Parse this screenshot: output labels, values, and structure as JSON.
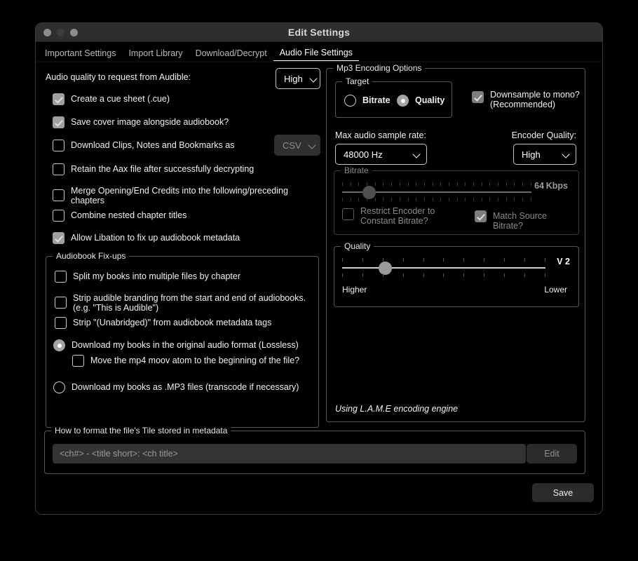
{
  "window": {
    "title": "Edit Settings",
    "traffic_lights": [
      "close-light",
      "minimize-light",
      "zoom-light"
    ]
  },
  "tabs": [
    {
      "label": "Important Settings",
      "active": false
    },
    {
      "label": "Import Library",
      "active": false
    },
    {
      "label": "Download/Decrypt",
      "active": false
    },
    {
      "label": "Audio File Settings",
      "active": true
    }
  ],
  "left": {
    "audio_quality_label": "Audio quality to request from Audible:",
    "audio_quality_value": "High",
    "checks": [
      {
        "label": "Create a cue sheet (.cue)",
        "checked": true
      },
      {
        "label": "Save cover image alongside audiobook?",
        "checked": true
      },
      {
        "label": "Download Clips, Notes and Bookmarks as",
        "checked": false
      },
      {
        "label": "Retain the Aax file after successfully decrypting",
        "checked": false
      },
      {
        "label": "Merge Opening/End Credits into the following/preceding chapters",
        "checked": false
      },
      {
        "label": "Combine nested chapter titles",
        "checked": false
      },
      {
        "label": "Allow Libation to fix up audiobook metadata",
        "checked": true
      }
    ],
    "clips_format_value": "CSV",
    "fixups": {
      "legend": "Audiobook Fix-ups",
      "checks": [
        {
          "label": "Split my books into multiple files by chapter",
          "checked": false
        },
        {
          "label": "Strip audible branding from the start and end of audiobooks. (e.g. \"This is Audible\")",
          "checked": false
        },
        {
          "label": "Strip \"(Unabridged)\" from audiobook metadata tags",
          "checked": false
        }
      ],
      "radio_lossless": {
        "label": "Download my books in the original audio format (Lossless)",
        "selected": true
      },
      "moov_check": {
        "label": "Move the mp4 moov atom to the beginning of the file?",
        "checked": false
      },
      "radio_mp3": {
        "label": "Download my books as .MP3 files (transcode if necessary)",
        "selected": false
      }
    }
  },
  "right": {
    "legend": "Mp3 Encoding Options",
    "target": {
      "legend": "Target",
      "options": [
        {
          "label": "Bitrate",
          "selected": false
        },
        {
          "label": "Quality",
          "selected": true
        }
      ]
    },
    "downsample": {
      "label": "Downsample to mono?\n(Recommended)",
      "line1": "Downsample to mono?",
      "line2": "(Recommended)",
      "checked": true,
      "enabled": false
    },
    "sample_rate_label": "Max audio sample rate:",
    "sample_rate_value": "48000 Hz",
    "encoder_quality_label": "Encoder Quality:",
    "encoder_quality_value": "High",
    "bitrate": {
      "legend": "Bitrate",
      "value": "64",
      "unit": "Kbps",
      "position_pct": 14,
      "enabled": false,
      "restrict_cbr": {
        "line1": "Restrict Encoder to",
        "line2": "Constant Bitrate?",
        "checked": false
      },
      "match_source": {
        "label": "Match Source Bitrate?",
        "checked": true
      }
    },
    "quality": {
      "legend": "Quality",
      "value": "V 2",
      "position_pct": 21,
      "low_label": "Higher",
      "high_label": "Lower"
    },
    "engine_note": "Using L.A.M.E encoding engine"
  },
  "bottom": {
    "legend": "How to format the file's Tile stored in metadata",
    "placeholder": "<ch#> - <title short>: <ch title>",
    "edit_label": "Edit",
    "save_label": "Save"
  }
}
